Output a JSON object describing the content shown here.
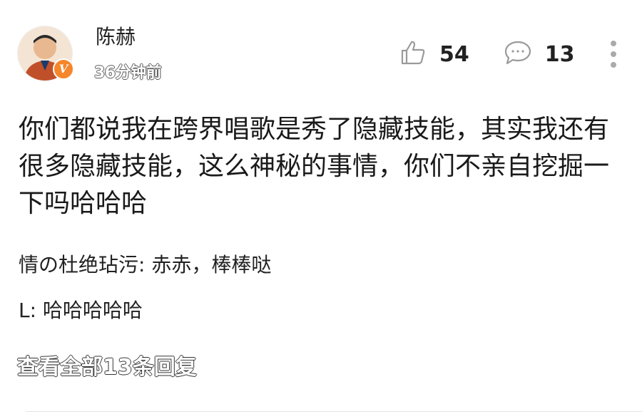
{
  "post": {
    "author": "陈赫",
    "timestamp": "36分钟前",
    "verified_badge": "V",
    "like_count": "54",
    "comment_count": "13",
    "text": "你们都说我在跨界唱歌是秀了隐藏技能，其实我还有很多隐藏技能，这么神秘的事情，你们不亲自挖掘一下吗哈哈哈"
  },
  "replies": [
    {
      "text": "情の杜绝玷污: 赤赤，棒棒哒"
    },
    {
      "text": "L: 哈哈哈哈哈"
    }
  ],
  "view_all_label": "查看全部13条回复",
  "icons": {
    "like": "thumbs-up-icon",
    "comment": "comment-bubble-icon",
    "more": "more-vertical-icon",
    "badge": "verified-v-icon"
  },
  "colors": {
    "badge": "#f5862a",
    "icon_stroke": "#9a9a9a",
    "text": "#1a1a1a",
    "divider": "#e4e4e4"
  }
}
